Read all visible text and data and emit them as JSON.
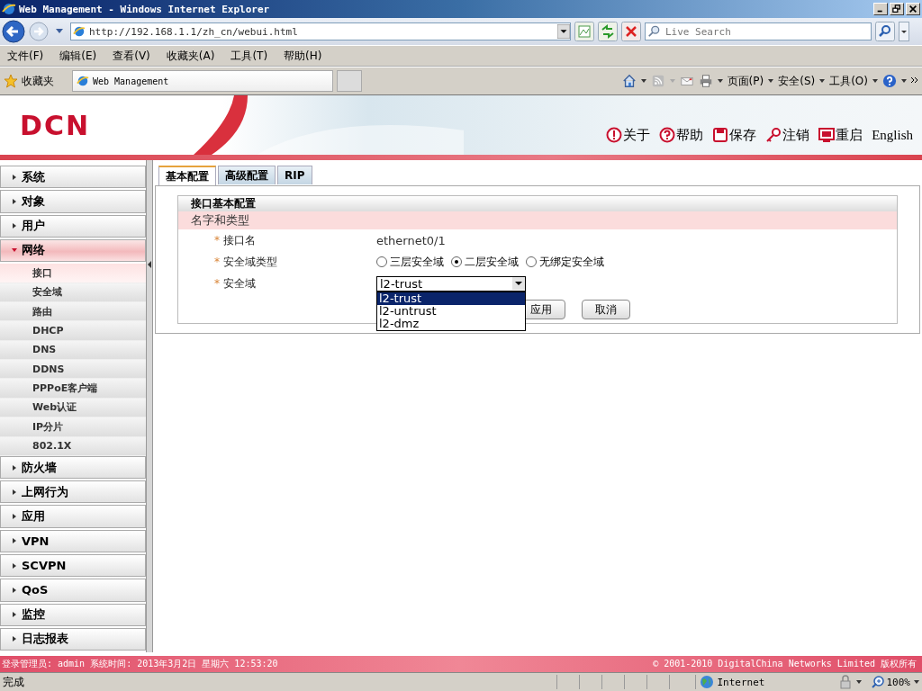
{
  "window": {
    "title": "Web Management - Windows Internet Explorer"
  },
  "address_bar": {
    "url": "http://192.168.1.1/zh_cn/webui.html"
  },
  "search": {
    "placeholder": "Live Search"
  },
  "menu_bar": [
    "文件(F)",
    "编辑(E)",
    "查看(V)",
    "收藏夹(A)",
    "工具(T)",
    "帮助(H)"
  ],
  "favorites": {
    "label": "收藏夹",
    "tab": "Web Management"
  },
  "command_bar": [
    "页面(P)",
    "安全(S)",
    "工具(O)"
  ],
  "header": {
    "logo": "DCN",
    "links": [
      {
        "kind": "about",
        "label": "关于"
      },
      {
        "kind": "help",
        "label": "帮助"
      },
      {
        "kind": "save",
        "label": "保存"
      },
      {
        "kind": "logout",
        "label": "注销"
      },
      {
        "kind": "reboot",
        "label": "重启"
      },
      {
        "kind": "text",
        "label": "English"
      }
    ]
  },
  "sidebar": {
    "items": [
      {
        "label": "系统",
        "expanded": false
      },
      {
        "label": "对象",
        "expanded": false
      },
      {
        "label": "用户",
        "expanded": false
      },
      {
        "label": "网络",
        "expanded": true,
        "children": [
          {
            "label": "接口",
            "selected": true
          },
          {
            "label": "安全域",
            "selected": false
          },
          {
            "label": "路由",
            "selected": false
          },
          {
            "label": "DHCP",
            "selected": false
          },
          {
            "label": "DNS",
            "selected": false
          },
          {
            "label": "DDNS",
            "selected": false
          },
          {
            "label": "PPPoE客户端",
            "selected": false
          },
          {
            "label": "Web认证",
            "selected": false
          },
          {
            "label": "IP分片",
            "selected": false
          },
          {
            "label": "802.1X",
            "selected": false
          }
        ]
      },
      {
        "label": "防火墙",
        "expanded": false
      },
      {
        "label": "上网行为",
        "expanded": false
      },
      {
        "label": "应用",
        "expanded": false
      },
      {
        "label": "VPN",
        "expanded": false
      },
      {
        "label": "SCVPN",
        "expanded": false
      },
      {
        "label": "QoS",
        "expanded": false
      },
      {
        "label": "监控",
        "expanded": false
      },
      {
        "label": "日志报表",
        "expanded": false
      }
    ]
  },
  "tabs": [
    {
      "label": "基本配置",
      "selected": true
    },
    {
      "label": "高级配置",
      "selected": false
    },
    {
      "label": "RIP",
      "selected": false
    }
  ],
  "form": {
    "title": "接口基本配置",
    "section": "名字和类型",
    "fields": [
      {
        "kind": "text",
        "marker": "*",
        "label": "接口名",
        "value": "ethernet0/1"
      },
      {
        "kind": "radio",
        "marker": "*",
        "label": "安全域类型",
        "options": [
          {
            "label": "三层安全域",
            "selected": false
          },
          {
            "label": "二层安全域",
            "selected": true
          },
          {
            "label": "无绑定安全域",
            "selected": false
          }
        ]
      },
      {
        "kind": "select",
        "marker": "*",
        "label": "安全域",
        "value": "l2-trust",
        "expanded": true,
        "options": [
          {
            "label": "l2-trust",
            "selected": true
          },
          {
            "label": "l2-untrust",
            "selected": false
          },
          {
            "label": "l2-dmz",
            "selected": false
          }
        ]
      }
    ],
    "buttons": [
      "应用",
      "取消"
    ]
  },
  "footer": {
    "left": "登录管理员: admin 系统时间: 2013年3月2日 星期六 12:53:20",
    "right": "© 2001-2010 DigitalChina Networks Limited 版权所有"
  },
  "status_bar": {
    "text": "完成",
    "zone": "Internet",
    "zoom": "100%"
  }
}
